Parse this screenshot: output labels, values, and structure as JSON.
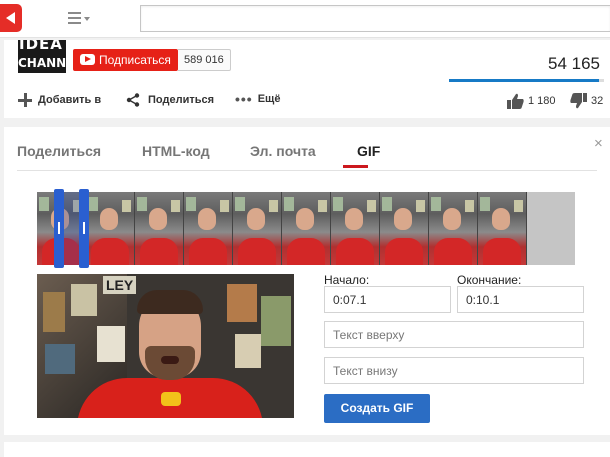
{
  "header": {
    "logo_icon": "youtube-logo-icon",
    "guide_icon": "guide-menu-icon",
    "search": {
      "value": "",
      "placeholder": ""
    }
  },
  "channel": {
    "logo_line1": "IDEA",
    "logo_line2": "CHANNEL",
    "subscribe_label": "Подписаться",
    "subscriber_count": "589 016",
    "view_count": "54 165",
    "like_ratio": 0.97
  },
  "actions": {
    "add_label": "Добавить в",
    "share_label": "Поделиться",
    "more_label": "Ещё",
    "likes": "1 180",
    "dislikes": "32"
  },
  "share_panel": {
    "tabs": [
      {
        "label": "Поделиться",
        "active": false
      },
      {
        "label": "HTML-код",
        "active": false
      },
      {
        "label": "Эл. почта",
        "active": false
      },
      {
        "label": "GIF",
        "active": true
      }
    ],
    "close_glyph": "×",
    "gif": {
      "start_label": "Начало:",
      "start_value": "0:07.1",
      "end_label": "Окончание:",
      "end_value": "0:10.1",
      "top_text_placeholder": "Текст вверху",
      "bottom_text_placeholder": "Текст внизу",
      "create_label": "Создать GIF",
      "preview_poster_text": "LEY"
    }
  },
  "colors": {
    "accent_red": "#e62117",
    "accent_blue": "#2b6dc4",
    "selection_blue": "#2a5fd0"
  }
}
